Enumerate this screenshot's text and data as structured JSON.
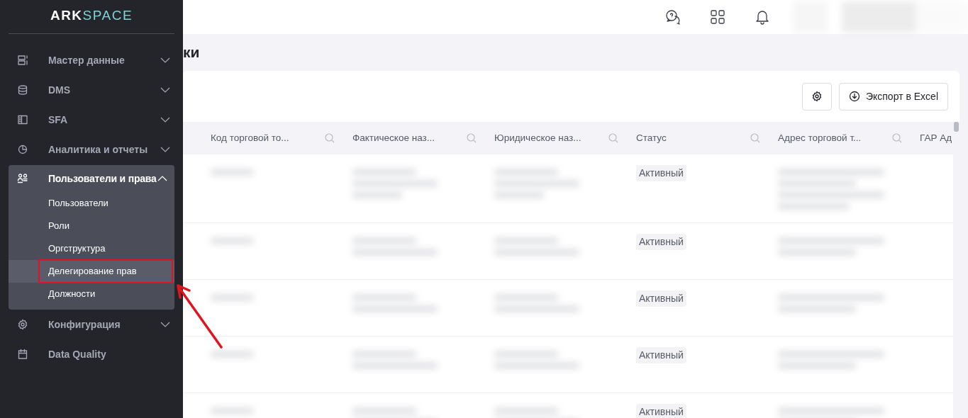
{
  "sidebar": {
    "logo": {
      "first": "ARK",
      "second": "SPACE"
    },
    "items": [
      {
        "label": "Мастер данные",
        "kind": "group",
        "expanded": false
      },
      {
        "label": "DMS",
        "kind": "group",
        "expanded": false
      },
      {
        "label": "SFA",
        "kind": "group",
        "expanded": false
      },
      {
        "label": "Аналитика и отчеты",
        "kind": "group",
        "expanded": false
      },
      {
        "label": "Пользователи и права",
        "kind": "group",
        "expanded": true,
        "children": [
          {
            "label": "Пользователи",
            "selected": false,
            "callout": false
          },
          {
            "label": "Роли",
            "selected": false,
            "callout": false
          },
          {
            "label": "Оргструктура",
            "selected": false,
            "callout": false
          },
          {
            "label": "Делегирование прав",
            "selected": true,
            "callout": true
          },
          {
            "label": "Должности",
            "selected": false,
            "callout": false
          }
        ]
      },
      {
        "label": "Конфигурация",
        "kind": "group",
        "expanded": false
      },
      {
        "label": "Data Quality",
        "kind": "link"
      }
    ]
  },
  "page": {
    "title": "ки"
  },
  "toolbar": {
    "export_button": "Экспорт в Excel"
  },
  "table": {
    "columns": [
      {
        "label": "Код торговой то..."
      },
      {
        "label": "Фактическое наз..."
      },
      {
        "label": "Юридическое наз..."
      },
      {
        "label": "Статус"
      },
      {
        "label": "Адрес торговой т..."
      },
      {
        "label": "ГАР Ад"
      }
    ],
    "rows": [
      {
        "status": "Активный"
      },
      {
        "status": "Активный"
      },
      {
        "status": "Активный"
      },
      {
        "status": "Активный"
      },
      {
        "status": "Активный"
      }
    ]
  }
}
